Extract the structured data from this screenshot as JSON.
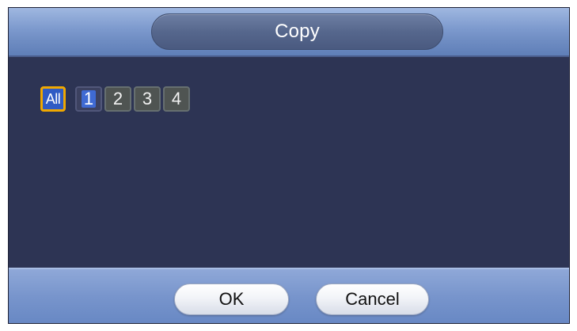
{
  "dialog": {
    "title": "Copy"
  },
  "channels": {
    "all_label": "All",
    "items": [
      {
        "label": "1",
        "selected": true
      },
      {
        "label": "2",
        "selected": false
      },
      {
        "label": "3",
        "selected": false
      },
      {
        "label": "4",
        "selected": false
      }
    ]
  },
  "buttons": {
    "ok_label": "OK",
    "cancel_label": "Cancel"
  },
  "colors": {
    "panel_background": "#2d3454",
    "title_bar": "#7c99cd",
    "focus_outline": "#f0a800",
    "selected_fill": "#3f6ad3"
  }
}
